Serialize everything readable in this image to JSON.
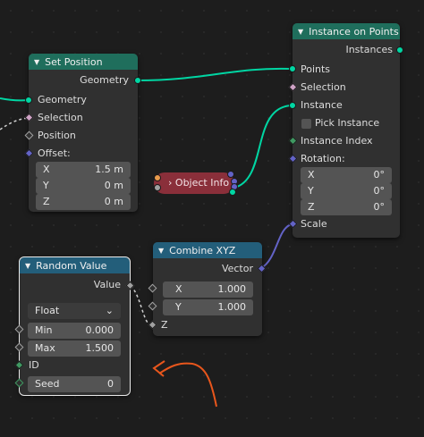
{
  "nodes": {
    "set_position": {
      "title": "Set Position",
      "output_geometry": "Geometry",
      "inputs": {
        "geometry": "Geometry",
        "selection": "Selection",
        "position": "Position",
        "offset": "Offset:"
      },
      "offset": {
        "x_label": "X",
        "x": "1.5 m",
        "y_label": "Y",
        "y": "0 m",
        "z_label": "Z",
        "z": "0 m"
      }
    },
    "instance_on_points": {
      "title": "Instance on Points",
      "output_instances": "Instances",
      "inputs": {
        "points": "Points",
        "selection": "Selection",
        "instance": "Instance",
        "pick_instance": "Pick Instance",
        "instance_index": "Instance Index",
        "rotation": "Rotation:",
        "scale": "Scale"
      },
      "rotation": {
        "x_label": "X",
        "x": "0°",
        "y_label": "Y",
        "y": "0°",
        "z_label": "Z",
        "z": "0°"
      }
    },
    "object_info": {
      "title": "Object Info"
    },
    "combine_xyz": {
      "title": "Combine XYZ",
      "output_vector": "Vector",
      "x_label": "X",
      "x": "1.000",
      "y_label": "Y",
      "y": "1.000",
      "z_label": "Z"
    },
    "random_value": {
      "title": "Random Value",
      "output_value": "Value",
      "type": "Float",
      "min_label": "Min",
      "min": "0.000",
      "max_label": "Max",
      "max": "1.500",
      "id_label": "ID",
      "seed_label": "Seed",
      "seed": "0"
    }
  },
  "colors": {
    "geometry_socket": "#00d6a3",
    "vector_socket": "#6363c7",
    "bool_socket": "#d0a3c6",
    "annotation": "#e8561c"
  }
}
